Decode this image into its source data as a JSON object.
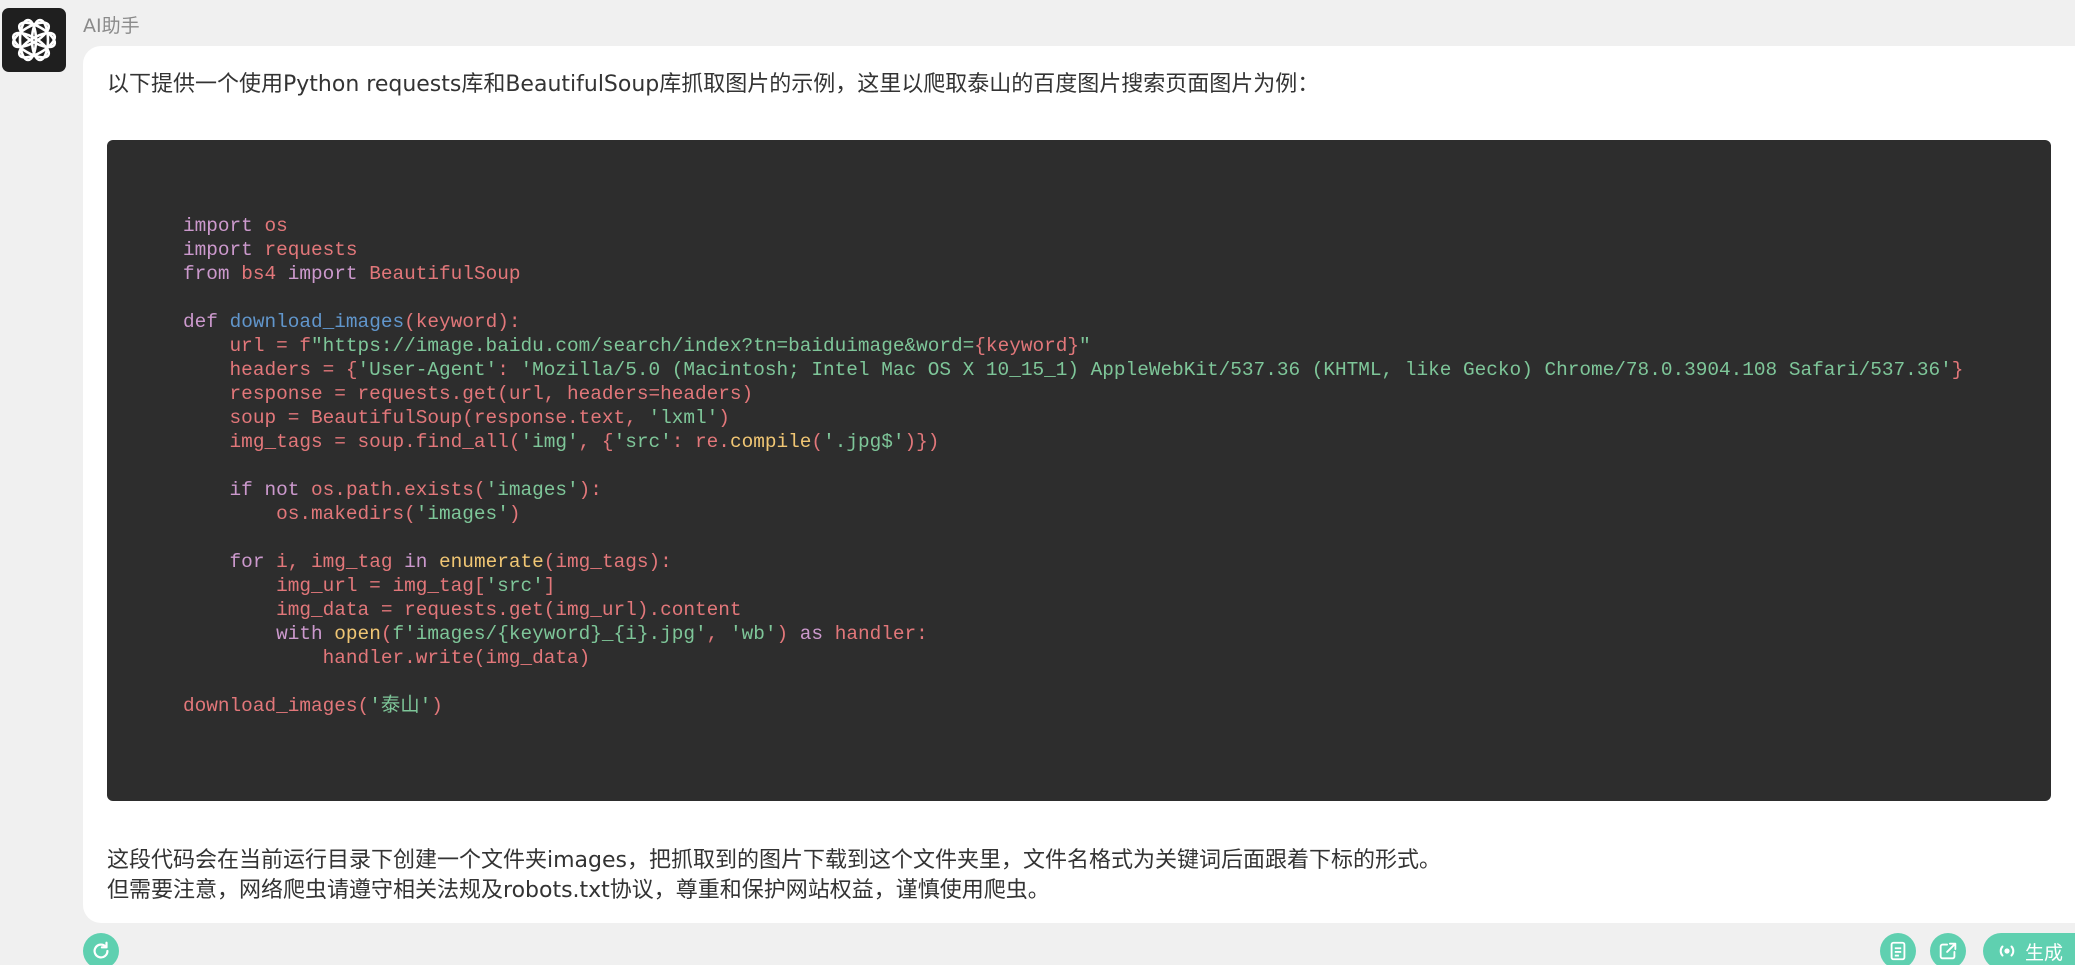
{
  "chat": {
    "assistant_name": "AI助手",
    "intro_text": "以下提供一个使用Python requests库和BeautifulSoup库抓取图片的示例，这里以爬取泰山的百度图片搜索页面图片为例：",
    "outro_line1": "这段代码会在当前运行目录下创建一个文件夹images，把抓取到的图片下载到这个文件夹里，文件名格式为关键词后面跟着下标的形式。",
    "outro_line2": "但需要注意，网络爬虫请遵守相关法规及robots.txt协议，尊重和保护网站权益，谨慎使用爬虫。"
  },
  "code": {
    "language": "python",
    "lines": [
      [
        [
          "kw",
          "import"
        ],
        [
          "p",
          " "
        ],
        [
          "id",
          "os"
        ]
      ],
      [
        [
          "kw",
          "import"
        ],
        [
          "p",
          " "
        ],
        [
          "id",
          "requests"
        ]
      ],
      [
        [
          "kw",
          "from"
        ],
        [
          "p",
          " "
        ],
        [
          "id",
          "bs4"
        ],
        [
          "p",
          " "
        ],
        [
          "kw",
          "import"
        ],
        [
          "p",
          " "
        ],
        [
          "id",
          "BeautifulSoup"
        ]
      ],
      [],
      [
        [
          "kw",
          "def"
        ],
        [
          "p",
          " "
        ],
        [
          "fn",
          "download_images"
        ],
        [
          "id",
          "(keyword):"
        ]
      ],
      [
        [
          "p",
          "    "
        ],
        [
          "id",
          "url = f"
        ],
        [
          "str",
          "\"https://image.baidu.com/search/index?tn=baiduimage&word="
        ],
        [
          "id",
          "{keyword}"
        ],
        [
          "str",
          "\""
        ]
      ],
      [
        [
          "p",
          "    "
        ],
        [
          "id",
          "headers = {"
        ],
        [
          "str",
          "'User-Agent'"
        ],
        [
          "id",
          ": "
        ],
        [
          "str",
          "'Mozilla/5.0 (Macintosh; Intel Mac OS X 10_15_1) AppleWebKit/537.36 (KHTML, like Gecko) Chrome/78.0.3904.108 Safari/537.36'"
        ],
        [
          "id",
          "}"
        ]
      ],
      [
        [
          "p",
          "    "
        ],
        [
          "id",
          "response = requests.get(url, headers=headers)"
        ]
      ],
      [
        [
          "p",
          "    "
        ],
        [
          "id",
          "soup = BeautifulSoup(response.text, "
        ],
        [
          "str",
          "'lxml'"
        ],
        [
          "id",
          ")"
        ]
      ],
      [
        [
          "p",
          "    "
        ],
        [
          "id",
          "img_tags = soup.find_all("
        ],
        [
          "str",
          "'img'"
        ],
        [
          "id",
          ", {"
        ],
        [
          "str",
          "'src'"
        ],
        [
          "id",
          ": re."
        ],
        [
          "bi",
          "compile"
        ],
        [
          "id",
          "("
        ],
        [
          "str",
          "'.jpg$'"
        ],
        [
          "id",
          ")})"
        ]
      ],
      [],
      [
        [
          "p",
          "    "
        ],
        [
          "kw",
          "if"
        ],
        [
          "p",
          " "
        ],
        [
          "kw",
          "not"
        ],
        [
          "p",
          " "
        ],
        [
          "id",
          "os.path.exists("
        ],
        [
          "str",
          "'images'"
        ],
        [
          "id",
          "):"
        ]
      ],
      [
        [
          "p",
          "        "
        ],
        [
          "id",
          "os.makedirs("
        ],
        [
          "str",
          "'images'"
        ],
        [
          "id",
          ")"
        ]
      ],
      [],
      [
        [
          "p",
          "    "
        ],
        [
          "kw",
          "for"
        ],
        [
          "p",
          " "
        ],
        [
          "id",
          "i, img_tag "
        ],
        [
          "kw",
          "in"
        ],
        [
          "p",
          " "
        ],
        [
          "bi",
          "enumerate"
        ],
        [
          "id",
          "(img_tags):"
        ]
      ],
      [
        [
          "p",
          "        "
        ],
        [
          "id",
          "img_url = img_tag["
        ],
        [
          "str",
          "'src'"
        ],
        [
          "id",
          "]"
        ]
      ],
      [
        [
          "p",
          "        "
        ],
        [
          "id",
          "img_data = requests.get(img_url).content"
        ]
      ],
      [
        [
          "p",
          "        "
        ],
        [
          "kw",
          "with"
        ],
        [
          "p",
          " "
        ],
        [
          "bi",
          "open"
        ],
        [
          "id",
          "("
        ],
        [
          "str",
          "f'images/{keyword}_{i}.jpg'"
        ],
        [
          "id",
          ", "
        ],
        [
          "str",
          "'wb'"
        ],
        [
          "id",
          ") "
        ],
        [
          "kw",
          "as"
        ],
        [
          "p",
          " "
        ],
        [
          "id",
          "handler:"
        ]
      ],
      [
        [
          "p",
          "            "
        ],
        [
          "id",
          "handler.write(img_data)"
        ]
      ],
      [],
      [
        [
          "id",
          "download_images("
        ],
        [
          "str",
          "'泰山'"
        ],
        [
          "id",
          ")"
        ]
      ]
    ]
  },
  "actions": {
    "regenerate_icon": "refresh-icon",
    "copy_icon": "document-icon",
    "share_icon": "share-icon",
    "generate_label": "生成"
  },
  "colors": {
    "accent": "#5fd0b0",
    "code_bg": "#2d2d2d",
    "keyword": "#cc99cd",
    "identifier": "#e2777a",
    "string": "#7ec699",
    "function": "#6196cc",
    "builtin": "#f0c674"
  }
}
